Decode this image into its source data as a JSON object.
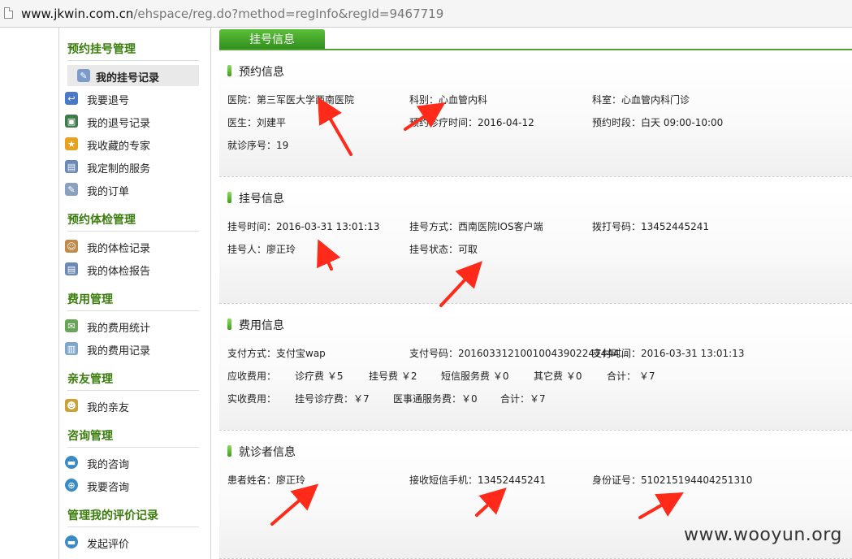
{
  "browser": {
    "url_host": "www.jkwin.com.cn",
    "url_path": "/ehspace/reg.do?method=regInfo&regId=9467719"
  },
  "sidebar": {
    "sections": [
      {
        "title": "预约挂号管理",
        "items": [
          "我的挂号记录",
          "我要退号",
          "我的退号记录",
          "我收藏的专家",
          "我定制的服务",
          "我的订单"
        ]
      },
      {
        "title": "预约体检管理",
        "items": [
          "我的体检记录",
          "我的体检报告"
        ]
      },
      {
        "title": "费用管理",
        "items": [
          "我的费用统计",
          "我的费用记录"
        ]
      },
      {
        "title": "亲友管理",
        "items": [
          "我的亲友"
        ]
      },
      {
        "title": "咨询管理",
        "items": [
          "我的咨询",
          "我要咨询"
        ]
      },
      {
        "title": "管理我的评价记录",
        "items": [
          "发起评价"
        ]
      }
    ]
  },
  "main": {
    "tab": "挂号信息",
    "appointment": {
      "title": "预约信息",
      "hospital": "医院：第三军医大学西南医院",
      "department": "科别：心血管内科",
      "clinic": "科室：心血管内科门诊",
      "doctor": "医生：刘建平",
      "date": "预约诊疗时间：2016-04-12",
      "period": "预约时段：白天 09:00-10:00",
      "seq": "就诊序号：19"
    },
    "registration": {
      "title": "挂号信息",
      "time": "挂号时间：2016-03-31 13:01:13",
      "method": "挂号方式：西南医院IOS客户端",
      "phone": "拨打号码：13452445241",
      "person": "挂号人：廖正玲",
      "status": "挂号状态：可取"
    },
    "fees": {
      "title": "费用信息",
      "pay_method": "支付方式：支付宝wap",
      "pay_no": "支付号码：20160331210010043902247444…",
      "pay_time": "支付时间：2016-03-31 13:01:13",
      "due_label": "应收费用：",
      "due_items": [
        "诊疗费 ￥5",
        "挂号费 ￥2",
        "短信服务费 ￥0",
        "其它费 ￥0",
        "合计： ￥7"
      ],
      "paid_label": "实收费用：",
      "paid_items": [
        "挂号诊疗费：￥7",
        "医事通服务费：￥0",
        "合计：￥7"
      ]
    },
    "patient": {
      "title": "就诊者信息",
      "name": "患者姓名：廖正玲",
      "sms_phone": "接收短信手机：13452445241",
      "id_no": "身份证号：510215194404251310"
    }
  },
  "watermark": "www.wooyun.org",
  "colors": {
    "accent_green": "#3b7d0d",
    "tab_green": "#4fa22f",
    "arrow_red": "#ff2a1a"
  },
  "icons": [
    "page-icon",
    "edit-icon",
    "user-return-icon",
    "monitor-icon",
    "star-icon",
    "id-card-icon",
    "order-icon",
    "checkup-user-icon",
    "report-icon",
    "fee-stats-icon",
    "fee-records-icon",
    "friends-icon",
    "consult-icon",
    "ask-icon",
    "review-icon"
  ]
}
